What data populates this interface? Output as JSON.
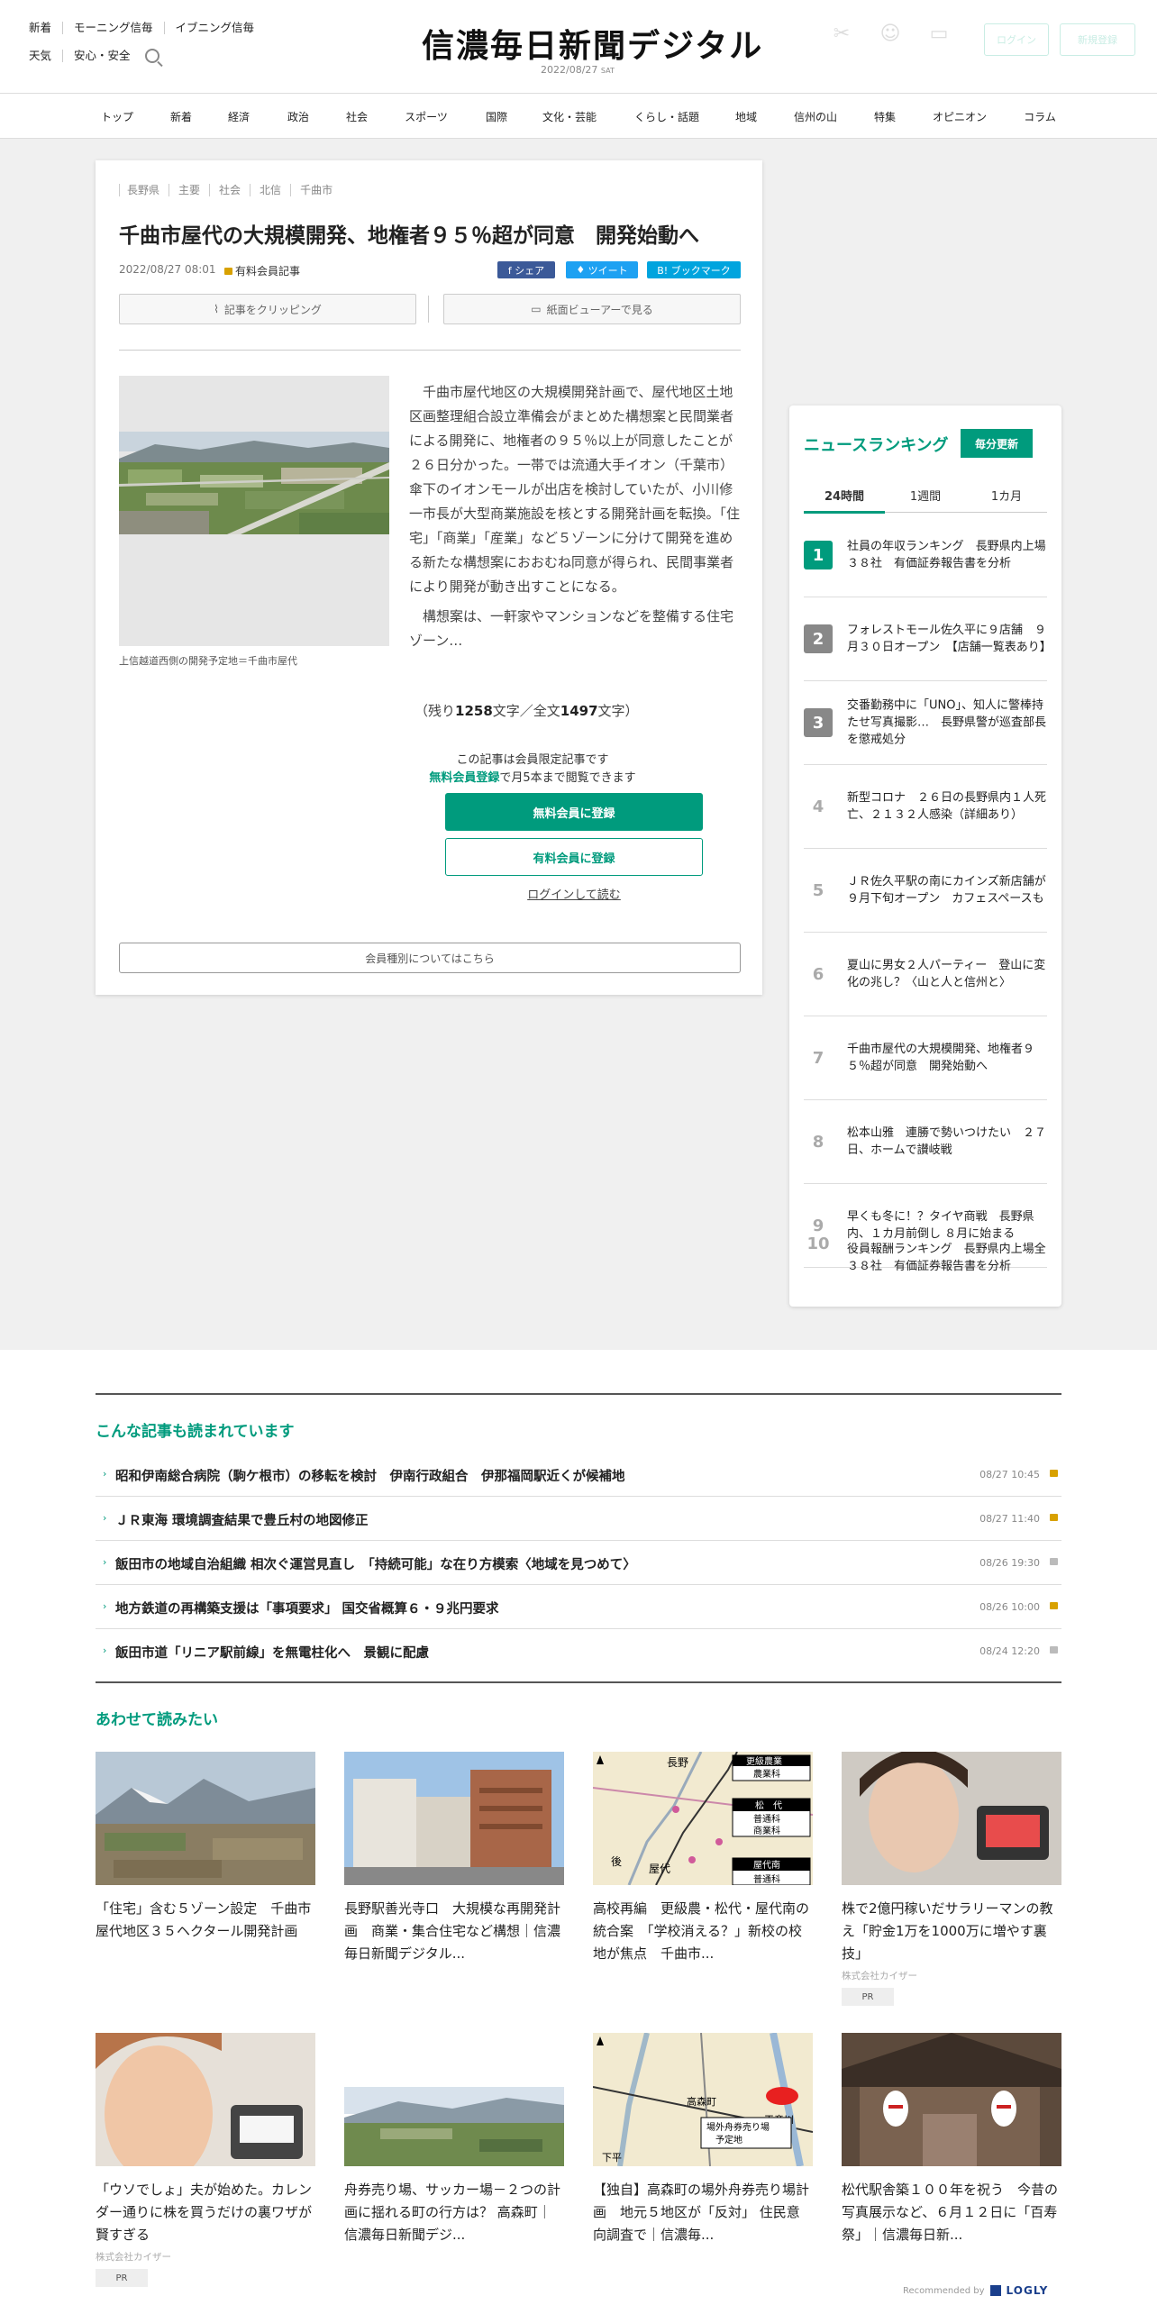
{
  "header": {
    "top_links": [
      "新着",
      "モーニング信毎",
      "イブニング信毎"
    ],
    "second_links": [
      "天気",
      "安心・安全"
    ],
    "logo": "信濃毎日新聞デジタル",
    "date": "2022/08/27",
    "weekday": "SAT",
    "login_label": "ログイン",
    "register_label": "新規登録",
    "icons": [
      "clipping-icon",
      "myfollow-icon",
      "viewer-icon"
    ]
  },
  "nav": [
    "トップ",
    "新着",
    "経済",
    "政治",
    "社会",
    "スポーツ",
    "国際",
    "文化・芸能",
    "くらし・話題",
    "地域",
    "信州の山",
    "特集",
    "オピニオン",
    "コラム"
  ],
  "article": {
    "tags": [
      "長野県",
      "主要",
      "社会",
      "北信",
      "千曲市"
    ],
    "title": "千曲市屋代の大規模開発、地権者９５％超が同意　開発始動へ",
    "date": "2022/08/27 08:01",
    "member_label": "有料会員記事",
    "share_fb": "f シェア",
    "share_tw": "ツイート",
    "share_hb": "B! ブックマーク",
    "clip_label": "記事をクリッピング",
    "paper_label": "紙面ビューアーで見る",
    "photo_caption": "上信越道西側の開発予定地＝千曲市屋代",
    "body_p1": "千曲市屋代地区の大規模開発計画で、屋代地区土地区画整理組合設立準備会がまとめた構想案と民間業者による開発に、地権者の９５％以上が同意したことが２６日分かった。一帯では流通大手イオン（千葉市）傘下のイオンモールが出店を検討していたが、小川修一市長が大型商業施設を核とする開発計画を転換。「住宅」「商業」「産業」など５ゾーンに分けて開発を進める新たな構想案におおむね同意が得られ、民間事業者により開発が動き出すことになる。",
    "body_p2": "構想案は、一軒家やマンションなどを整備する住宅ゾーン…",
    "remain_prefix": "（残り",
    "remain_count": "1258",
    "remain_mid": "文字／全文",
    "total_count": "1497",
    "remain_suffix": "文字）",
    "limited_text": "この記事は会員限定記事です",
    "limited_link": "無料会員登録",
    "limited_suffix": "で月5本まで閲覧できます",
    "free_register": "無料会員に登録",
    "paid_register": "有料会員に登録",
    "login_link": "ログインして読む",
    "member_types": "会員種別についてはこちら"
  },
  "ranking": {
    "title": "ニュースランキング",
    "badge": "毎分更新",
    "tabs": [
      "24時間",
      "1週間",
      "1カ月"
    ],
    "items": [
      {
        "rank": "1",
        "text": "社員の年収ランキング　長野県内上場３８社　有価証券報告書を分析"
      },
      {
        "rank": "2",
        "text": "フォレストモール佐久平に９店舗　９月３０日オープン　【店舗一覧表あり】"
      },
      {
        "rank": "3",
        "text": "交番勤務中に「UNO」、知人に警棒持たせ写真撮影…　長野県警が巡査部長を懲戒処分"
      },
      {
        "rank": "4",
        "text": "新型コロナ　２６日の長野県内１人死亡、２１３２人感染（詳細あり）"
      },
      {
        "rank": "5",
        "text": "ＪＲ佐久平駅の南にカインズ新店舗が９月下旬オープン　カフェスペースも"
      },
      {
        "rank": "6",
        "text": "夏山に男女２人パーティー　登山に変化の兆し？〈山と人と信州と〉"
      },
      {
        "rank": "7",
        "text": "千曲市屋代の大規模開発、地権者９５％超が同意　開発始動へ"
      },
      {
        "rank": "8",
        "text": "松本山雅　連勝で勢いつけたい　２７日、ホームで讃岐戦"
      },
      {
        "rank": "9",
        "text": "早くも冬に！？タイヤ商戦　長野県内、１カ月前倒し ８月に始まる"
      },
      {
        "rank": "10",
        "text": "役員報酬ランキング　長野県内上場全３８社　有価証券報告書を分析"
      }
    ]
  },
  "popular": {
    "title": "こんな記事も読まれています",
    "items": [
      {
        "text": "昭和伊南総合病院（駒ケ根市）の移転を検討　伊南行政組合　伊那福岡駅近くが候補地",
        "date": "08/27 10:45"
      },
      {
        "text": "ＪＲ東海 環境調査結果で豊丘村の地図修正",
        "date": "08/27 11:40"
      },
      {
        "text": "飯田市の地域自治組織 相次ぐ運営見直し　「持続可能」な在り方模索〈地域を見つめて〉",
        "date": "08/26 19:30"
      },
      {
        "text": "地方鉄道の再構築支援は「事項要求」 国交省概算６・９兆円要求",
        "date": "08/26 10:00"
      },
      {
        "text": "飯田市道「リニア駅前線」を無電柱化へ　景観に配慮",
        "date": "08/24 12:20"
      }
    ]
  },
  "recommend": {
    "title": "あわせて読みたい",
    "map1_labels": [
      "長野",
      "更級農業",
      "農業科",
      "松　代",
      "普通科",
      "商業科",
      "屋代南",
      "普通科",
      "後",
      "屋代"
    ],
    "map2_labels": [
      "高森町",
      "天竜川",
      "場外舟券売り場",
      "予定地",
      "下平"
    ],
    "cards": [
      {
        "text": "「住宅」含む５ゾーン設定　千曲市屋代地区３５ヘクタール開発計画",
        "source": "",
        "pr": ""
      },
      {
        "text": "長野駅善光寺口　大規模な再開発計画　商業・集合住宅など構想｜信濃毎日新聞デジタル...",
        "source": "",
        "pr": ""
      },
      {
        "text": "高校再編　更級農・松代・屋代南の統合案　「学校消える？」新校の校地が焦点　千曲市...",
        "source": "",
        "pr": ""
      },
      {
        "text": "株で2億円稼いだサラリーマンの教え「貯金1万を1000万に増やす裏技」",
        "source": "株式会社カイザー",
        "pr": "PR"
      },
      {
        "text": "「ウソでしょ」夫が始めた。カレンダー通りに株を買うだけの裏ワザが賢すぎる",
        "source": "株式会社カイザー",
        "pr": "PR"
      },
      {
        "text": "舟券売り場、サッカー場－２つの計画に揺れる町の行方は？ 高森町｜信濃毎日新聞デジ...",
        "source": "",
        "pr": ""
      },
      {
        "text": "【独自】高森町の場外舟券売り場計画　地元５地区が「反対」 住民意向調査で｜信濃毎...",
        "source": "",
        "pr": ""
      },
      {
        "text": "松代駅舎築１００年を祝う　今昔の写真展示など、６月１２日に「百寿祭」｜信濃毎日新...",
        "source": "",
        "pr": ""
      }
    ],
    "recommended_by": "Recommended by",
    "logly": "LOGLY"
  },
  "colors": {
    "accent": "#009b7d",
    "lock": "#d8a100"
  }
}
